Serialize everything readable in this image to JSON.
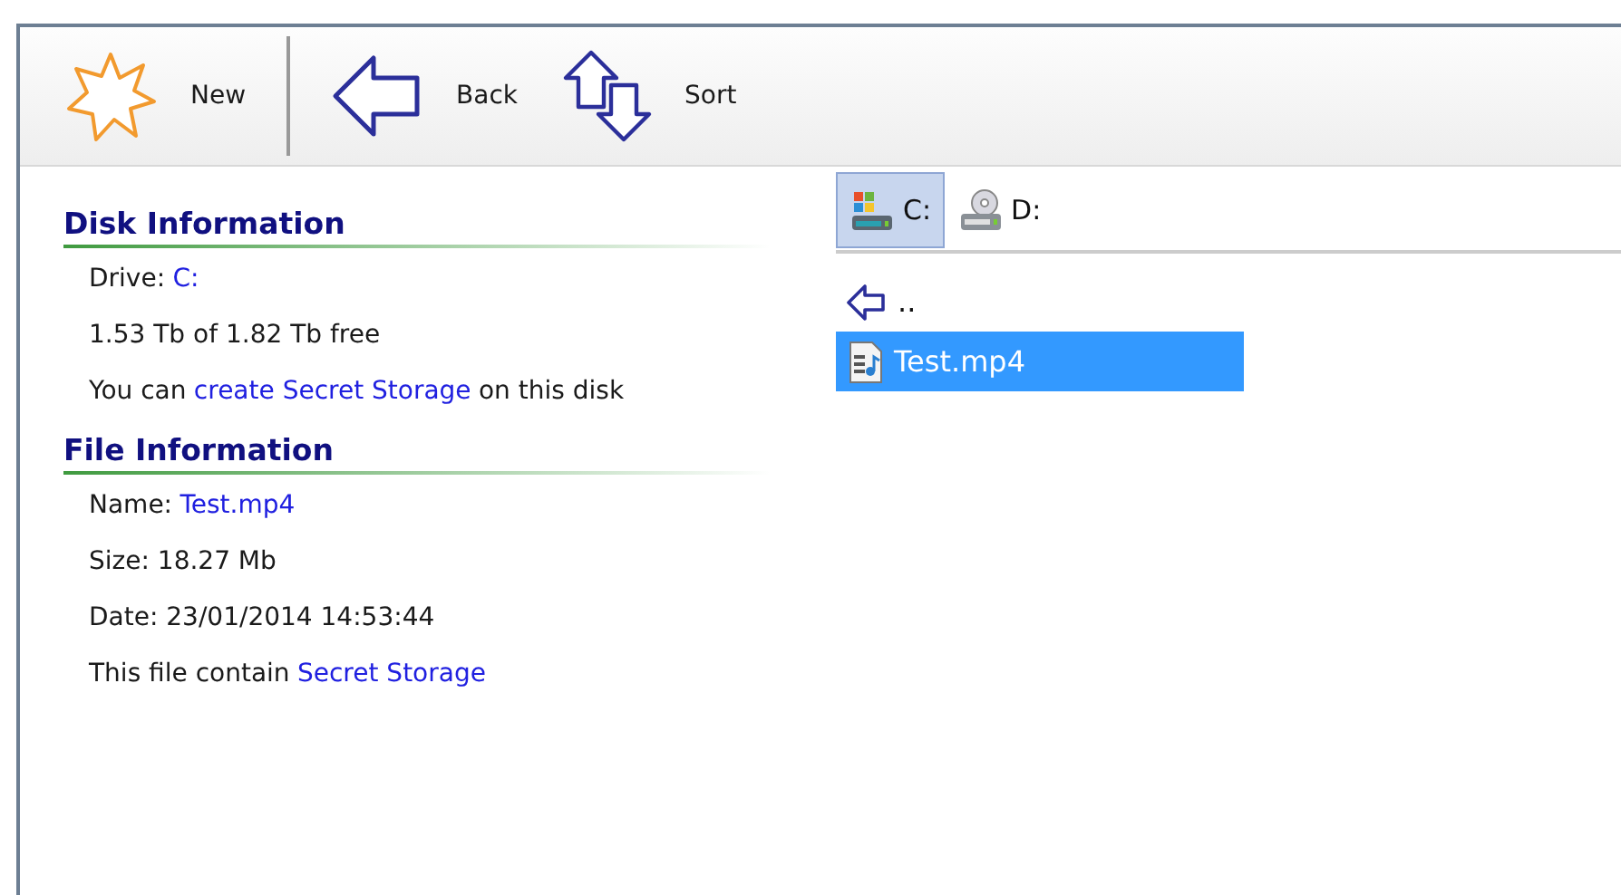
{
  "toolbar": [
    {
      "kind": "new",
      "label": "New"
    },
    {
      "kind": "separator"
    },
    {
      "kind": "back",
      "label": "Back"
    },
    {
      "kind": "sort",
      "label": "Sort"
    }
  ],
  "sections": [
    {
      "title": "Disk Information",
      "lines": [
        {
          "before": "Drive:",
          "link": "C:"
        },
        {
          "before": "1.53 Tb of 1.82 Tb free"
        },
        {
          "before": "You can",
          "link": "create Secret Storage",
          "after": "on this disk"
        }
      ]
    },
    {
      "title": "File Information",
      "lines": [
        {
          "before": "Name:",
          "link": "Test.mp4"
        },
        {
          "before": "Size: 18.27 Mb"
        },
        {
          "before": "Date: 23/01/2014 14:53:44"
        },
        {
          "before": "This file contain",
          "link": "Secret Storage"
        }
      ]
    }
  ],
  "drives": [
    {
      "kind": "system",
      "label": "C:",
      "selected": true
    },
    {
      "kind": "disc",
      "label": "D:",
      "selected": false
    }
  ],
  "files": [
    {
      "kind": "parent",
      "label": "..",
      "selected": false
    },
    {
      "kind": "video",
      "label": "Test.mp4",
      "selected": true
    }
  ]
}
